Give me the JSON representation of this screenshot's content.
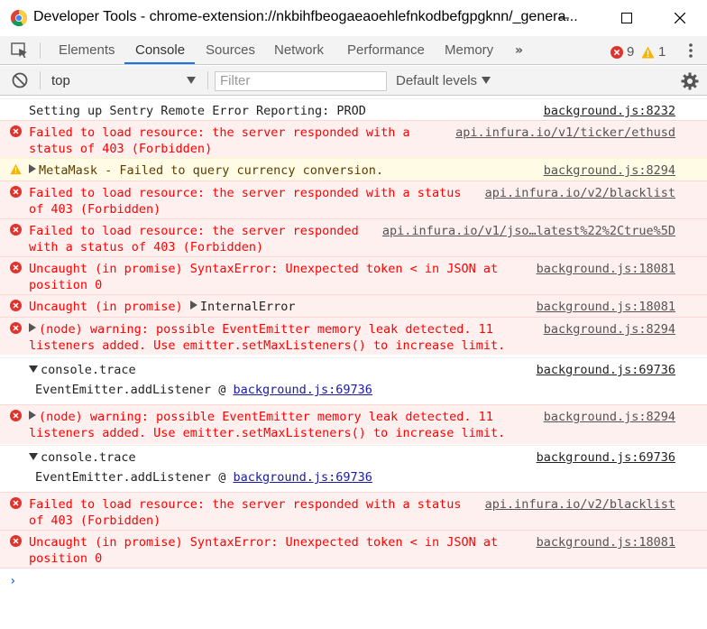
{
  "window": {
    "title": "Developer Tools - chrome-extension://nkbihfbeogaeaoehlefnkodbefgpgknn/_genera..."
  },
  "tabs": [
    {
      "label": "Elements"
    },
    {
      "label": "Console"
    },
    {
      "label": "Sources"
    },
    {
      "label": "Network"
    },
    {
      "label": "Performance"
    },
    {
      "label": "Memory"
    }
  ],
  "more_tabs": "»",
  "counts": {
    "errors": "9",
    "warnings": "1"
  },
  "toolbar": {
    "context": "top",
    "filter_placeholder": "Filter",
    "levels": "Default levels"
  },
  "colors": {
    "accent": "#1a73e8",
    "error_text": "#ff0000",
    "error_bg": "#fff0f0",
    "warning_bg": "#fffbe5"
  },
  "messages": [
    {
      "level": "log",
      "text": "Setting up Sentry Remote Error Reporting: PROD",
      "source": "background.js:8232"
    },
    {
      "level": "error",
      "text": "Failed to load resource: the server responded with a\nstatus of 403 (Forbidden)",
      "source": "api.infura.io/v1/ticker/ethusd"
    },
    {
      "level": "warning",
      "text": "MetaMask - Failed to query currency conversion.",
      "source": "background.js:8294"
    },
    {
      "level": "error",
      "text": "Failed to load resource: the server responded with a status\nof 403 (Forbidden)",
      "source": "api.infura.io/v2/blacklist"
    },
    {
      "level": "error",
      "text": "Failed to load resource: the server responded\nwith a status of 403 (Forbidden)",
      "source": "api.infura.io/v1/jso…latest%22%2Ctrue%5D"
    },
    {
      "level": "error",
      "text": "Uncaught (in promise) SyntaxError: Unexpected token < in JSON at\nposition 0",
      "source": "background.js:18081"
    },
    {
      "level": "error",
      "text_prefix": "Uncaught (in promise) ",
      "text_obj": "InternalError",
      "source": "background.js:18081"
    },
    {
      "level": "error",
      "text": "(node) warning: possible EventEmitter memory leak detected. 11\nlisteners added. Use emitter.setMaxListeners() to increase limit.",
      "source": "background.js:8294"
    },
    {
      "level": "log",
      "text": "console.trace",
      "source": "background.js:69736",
      "trace_fn": "EventEmitter.addListener",
      "trace_link": "background.js:69736"
    },
    {
      "level": "error",
      "text": "(node) warning: possible EventEmitter memory leak detected. 11\nlisteners added. Use emitter.setMaxListeners() to increase limit.",
      "source": "background.js:8294"
    },
    {
      "level": "log",
      "text": "console.trace",
      "source": "background.js:69736",
      "trace_fn": "EventEmitter.addListener",
      "trace_link": "background.js:69736"
    },
    {
      "level": "error",
      "text": "Failed to load resource: the server responded with a status\nof 403 (Forbidden)",
      "source": "api.infura.io/v2/blacklist"
    },
    {
      "level": "error",
      "text": "Uncaught (in promise) SyntaxError: Unexpected token < in JSON at\nposition 0",
      "source": "background.js:18081"
    }
  ],
  "prompt_symbol": "›"
}
